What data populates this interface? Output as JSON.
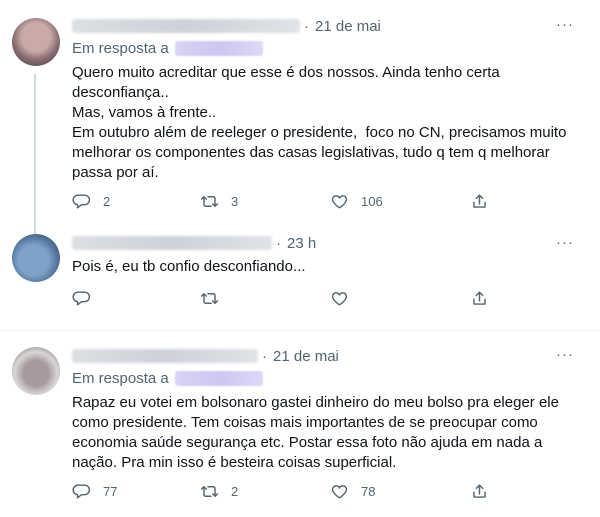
{
  "tweets": [
    {
      "time": "21 de mai",
      "reply_prefix": "Em resposta a",
      "lines": [
        "Quero muito acreditar que esse é dos nossos. Ainda tenho certa",
        "desconfiança..",
        "Mas, vamos à frente..",
        "Em outubro além de reeleger o presidente,  foco no CN, precisamos muito",
        "melhorar os componentes das casas legislativas, tudo q tem q melhorar",
        "passa por aí."
      ],
      "replies": "2",
      "retweets": "3",
      "likes": "106"
    },
    {
      "time": "23 h",
      "lines": [
        "Pois é, eu tb confio desconfiando..."
      ],
      "replies": "",
      "retweets": "",
      "likes": ""
    },
    {
      "time": "21 de mai",
      "reply_prefix": "Em resposta a",
      "lines": [
        "Rapaz eu votei em bolsonaro gastei dinheiro do meu bolso pra eleger ele",
        "como presidente. Tem coisas mais importantes de se preocupar como",
        "economia saúde segurança etc. Postar essa foto não ajuda em nada a",
        "nação. Pra min isso é besteira coisas superficial."
      ],
      "replies": "77",
      "retweets": "2",
      "likes": "78"
    }
  ],
  "separator": "·",
  "more_glyph": "···",
  "icons": [
    "reply-icon",
    "retweet-icon",
    "like-icon",
    "share-icon",
    "more-icon"
  ],
  "colors": {
    "text": "#0f1419",
    "secondary": "#536471",
    "thread_line": "#cfd9de",
    "redacted_handle": "#cdc6f1"
  }
}
